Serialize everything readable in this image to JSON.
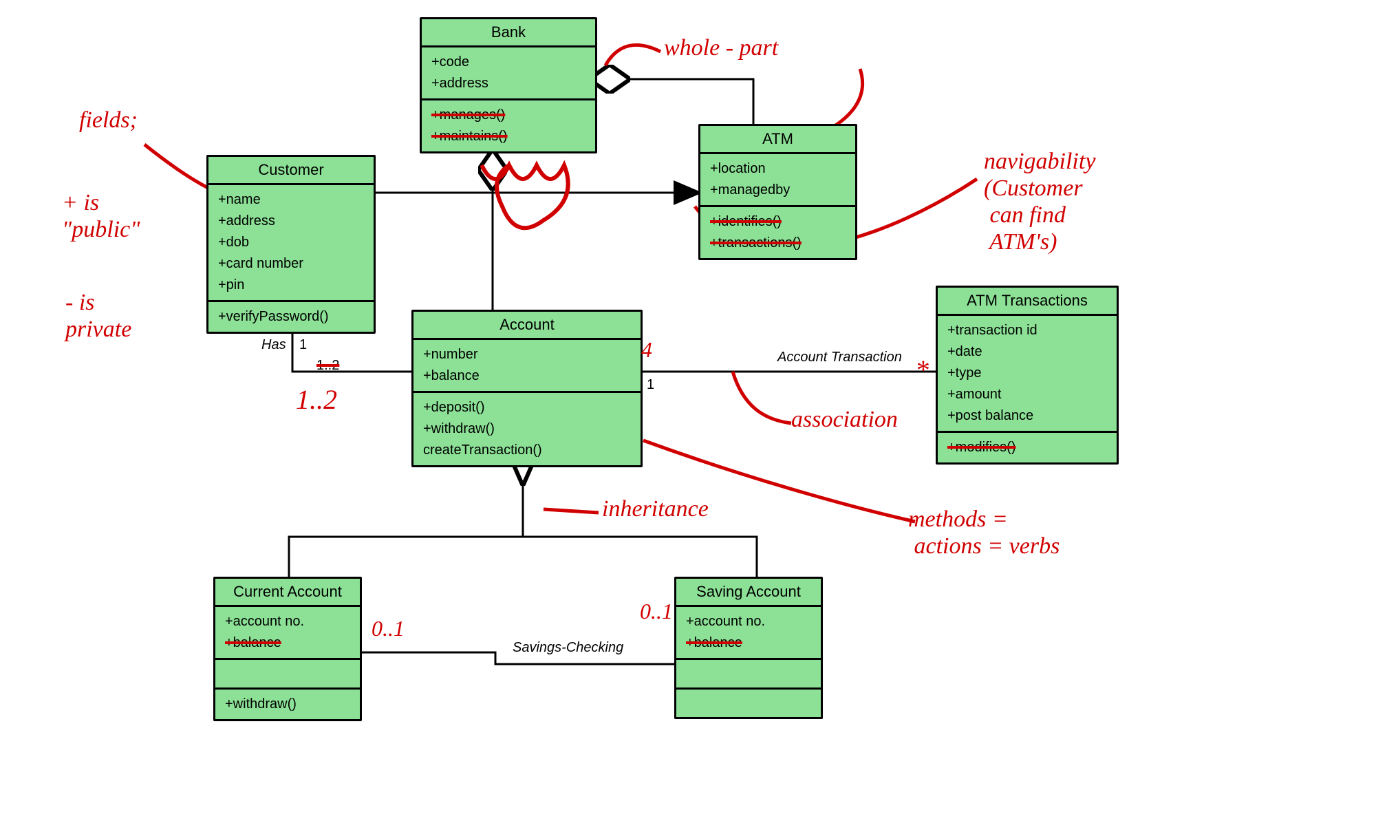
{
  "classes": {
    "bank": {
      "title": "Bank",
      "attrs": [
        "+code",
        "+address"
      ],
      "ops": [
        "+manages()",
        "+maintains()"
      ],
      "struck_ops": [
        0,
        1
      ]
    },
    "customer": {
      "title": "Customer",
      "attrs": [
        "+name",
        "+address",
        "+dob",
        "+card number",
        "+pin"
      ],
      "ops": [
        "+verifyPassword()"
      ]
    },
    "atm": {
      "title": "ATM",
      "attrs": [
        "+location",
        "+managedby"
      ],
      "ops": [
        "+identifies()",
        "+transactions()"
      ],
      "struck_ops": [
        0,
        1
      ]
    },
    "account": {
      "title": "Account",
      "attrs": [
        "+number",
        "+balance"
      ],
      "ops": [
        "+deposit()",
        "+withdraw()",
        "createTransaction()"
      ]
    },
    "atmtx": {
      "title": "ATM Transactions",
      "attrs": [
        "+transaction id",
        "+date",
        "+type",
        "+amount",
        "+post balance"
      ],
      "ops": [
        "+modifies()"
      ],
      "struck_ops": [
        0
      ]
    },
    "current": {
      "title": "Current Account",
      "attrs": [
        "+account no.",
        "+balance"
      ],
      "ops": [
        "+withdraw()"
      ],
      "struck_attrs": [
        1
      ]
    },
    "saving": {
      "title": "Saving Account",
      "attrs": [
        "+account no.",
        "+balance"
      ],
      "ops": [],
      "struck_attrs": [
        1
      ]
    }
  },
  "edge_labels": {
    "has": "Has",
    "has_m1": "1",
    "has_m2": "1..2",
    "acct_tx": "Account Transaction",
    "acct_m1": "1",
    "sav_chk": "Savings-Checking"
  },
  "annotations": {
    "fields": "fields;",
    "public": "+ is\n\"public\"",
    "private": "- is\nprivate",
    "one_two": "1..2",
    "whole_part": "whole - part",
    "nav": "navigability\n(Customer\n can find\n ATM's)",
    "assoc": "association",
    "inherit": "inheritance",
    "methods": "methods =\n actions = verbs",
    "cur01": "0..1",
    "sav01": "0..1",
    "star": "*",
    "four": "4"
  }
}
